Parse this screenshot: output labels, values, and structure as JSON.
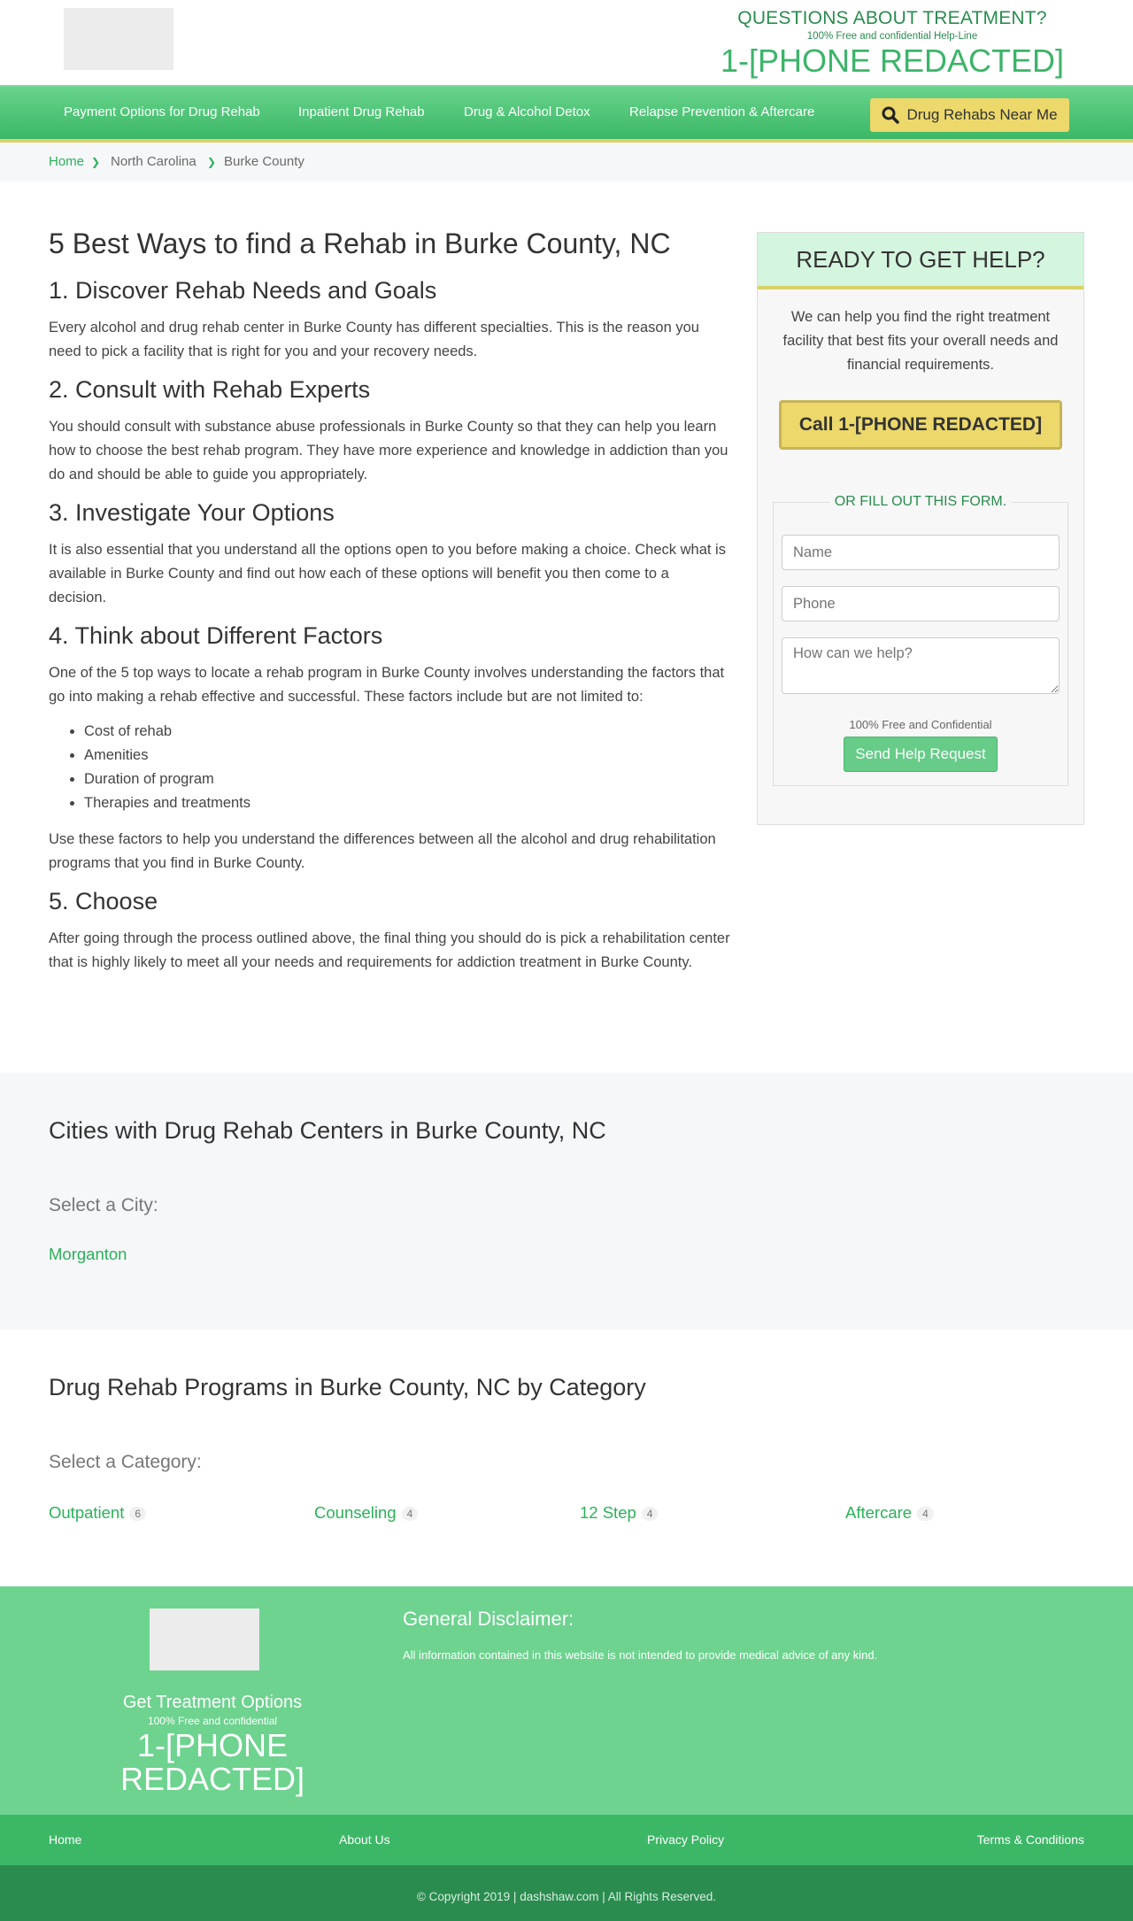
{
  "header": {
    "questions": "QUESTIONS ABOUT TREATMENT?",
    "helpline": "100% Free and confidential Help-Line",
    "phone": "1-[PHONE REDACTED]"
  },
  "nav": {
    "items": [
      "Payment Options for Drug Rehab",
      "Inpatient Drug Rehab",
      "Drug & Alcohol Detox",
      "Relapse Prevention & Aftercare"
    ],
    "search_label": "Drug Rehabs Near Me"
  },
  "breadcrumb": [
    "Home",
    "North Carolina",
    "Burke County"
  ],
  "article": {
    "title": "5 Best Ways to find a Rehab in Burke County, NC",
    "s1_title": "1. Discover Rehab Needs and Goals",
    "s1_text": "Every alcohol and drug rehab center in Burke County has different specialties. This is the reason you need to pick a facility that is right for you and your recovery needs.",
    "s2_title": "2. Consult with Rehab Experts",
    "s2_text": "You should consult with substance abuse professionals in Burke County so that they can help you learn how to choose the best rehab program. They have more experience and knowledge in addiction than you do and should be able to guide you appropriately.",
    "s3_title": "3. Investigate Your Options",
    "s3_text": "It is also essential that you understand all the options open to you before making a choice. Check what is available in Burke County and find out how each of these options will benefit you then come to a decision.",
    "s4_title": "4. Think about Different Factors",
    "s4_text": "One of the 5 top ways to locate a rehab program in Burke County involves understanding the factors that go into making a rehab effective and successful. These factors include but are not limited to:",
    "factors": [
      "Cost of rehab",
      "Amenities",
      "Duration of program",
      "Therapies and treatments"
    ],
    "s4_after": "Use these factors to help you understand the differences between all the alcohol and drug rehabilitation programs that you find in Burke County.",
    "s5_title": "5. Choose",
    "s5_text": "After going through the process outlined above, the final thing you should do is pick a rehabilitation center that is highly likely to meet all your needs and requirements for addiction treatment in Burke County."
  },
  "sidebar": {
    "title": "READY TO GET HELP?",
    "text": "We can help you find the right treatment facility that best fits your overall needs and financial requirements.",
    "call_label": "Call 1-[PHONE REDACTED]",
    "form_legend": "OR FILL OUT THIS FORM.",
    "name_placeholder": "Name",
    "phone_placeholder": "Phone",
    "help_placeholder": "How can we help?",
    "free_note": "100% Free and Confidential",
    "send_label": "Send Help Request"
  },
  "cities": {
    "title": "Cities with Drug Rehab Centers in Burke County, NC",
    "select_label": "Select a City:",
    "items": [
      "Morganton"
    ]
  },
  "categories": {
    "title": "Drug Rehab Programs in Burke County, NC by Category",
    "select_label": "Select a Category:",
    "items": [
      {
        "label": "Outpatient",
        "count": "6"
      },
      {
        "label": "Counseling",
        "count": "4"
      },
      {
        "label": "12 Step",
        "count": "4"
      },
      {
        "label": "Aftercare",
        "count": "4"
      }
    ]
  },
  "footer": {
    "get_treatment": "Get Treatment Options",
    "free_conf": "100% Free and confidential",
    "phone": "1-[PHONE REDACTED]",
    "disclaimer_title": "General Disclaimer:",
    "disclaimer_text": "All information contained in this website is not intended to provide medical advice of any kind.",
    "links": [
      "Home",
      "About Us",
      "Privacy Policy",
      "Terms & Conditions"
    ],
    "copyright": "© Copyright 2019 | dashshaw.com | All Rights Reserved."
  },
  "colors": {
    "brand_green": "#3cb766",
    "dark_green": "#2a8c4f",
    "accent_yellow": "#ecd86b"
  }
}
